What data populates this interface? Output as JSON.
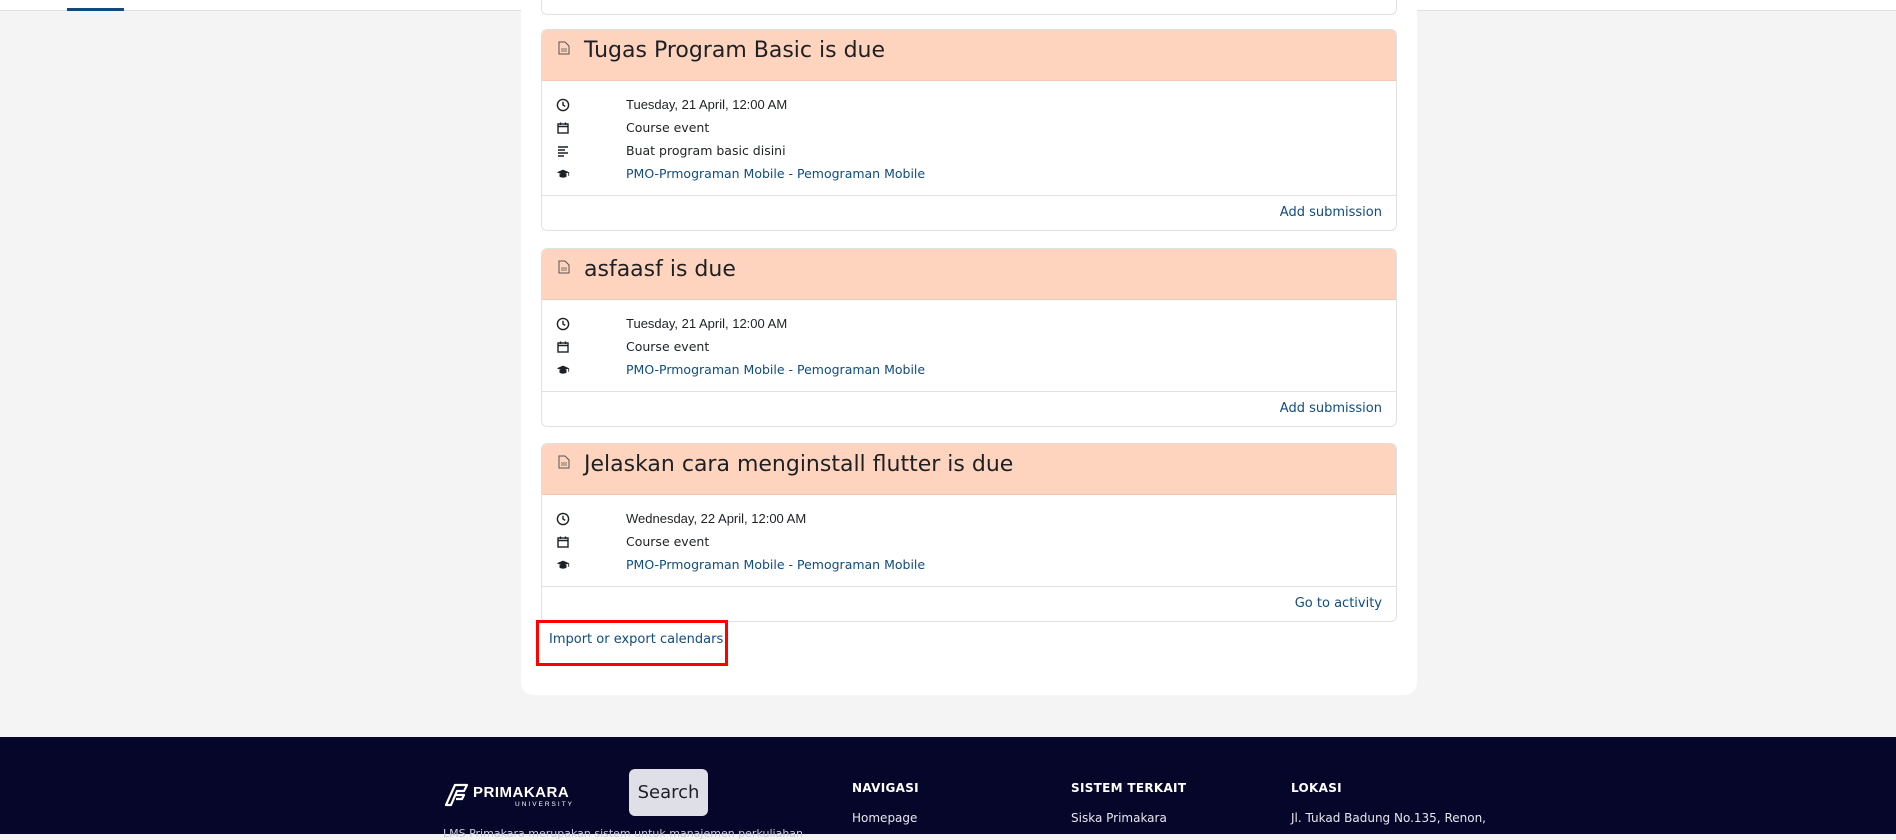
{
  "events": [
    {
      "title": "Tugas Program Basic is due",
      "date": "Tuesday, 21 April, 12:00 AM",
      "event_type": "Course event",
      "description": "Buat program basic disini",
      "course": "PMO-Prmograman Mobile - Pemograman Mobile",
      "action": "Add submission"
    },
    {
      "title": "asfaasf is due",
      "date": "Tuesday, 21 April, 12:00 AM",
      "event_type": "Course event",
      "course": "PMO-Prmograman Mobile - Pemograman Mobile",
      "action": "Add submission"
    },
    {
      "title": "Jelaskan cara menginstall flutter is due",
      "date": "Wednesday, 22 April, 12:00 AM",
      "event_type": "Course event",
      "course": "PMO-Prmograman Mobile - Pemograman Mobile",
      "action": "Go to activity"
    }
  ],
  "import_export_label": "Import or export calendars",
  "footer": {
    "brand": "PRIMAKARA",
    "brand_sub": "UNIVERSITY",
    "description": "LMS Primakara merupakan sistem untuk manajemen perkuliahan",
    "search_label": "Search",
    "columns": [
      {
        "heading": "NAVIGASI",
        "first_link": "Homepage"
      },
      {
        "heading": "SISTEM TERKAIT",
        "first_link": "Siska Primakara"
      },
      {
        "heading": "LOKASI",
        "first_link": "Jl. Tukad Badung No.135, Renon,"
      }
    ]
  },
  "colors": {
    "event_header": "#ffd4be",
    "link": "#0f4c81",
    "footer_bg": "#06062a",
    "highlight": "#ff0000"
  },
  "icons": {
    "event_title": "document-icon",
    "date": "clock-icon",
    "event_type": "calendar-icon",
    "description": "align-left-icon",
    "course": "graduation-cap-icon"
  }
}
